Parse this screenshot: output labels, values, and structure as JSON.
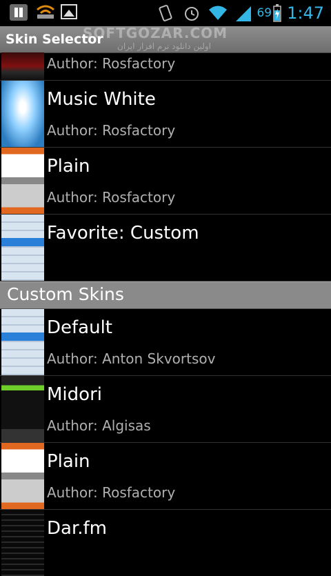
{
  "statusbar": {
    "battery_percent": "69",
    "time": "1:47",
    "accent_color": "#33b5e5",
    "icons": [
      "pause-icon",
      "wifi-signal-icon",
      "image-icon",
      "vibrate-icon",
      "alarm-icon",
      "wifi-icon",
      "cell-signal-icon",
      "battery-charging-icon"
    ]
  },
  "titlebar": {
    "title": "Skin Selector",
    "watermark": "SOFTGOZAR.COM",
    "watermark_sub": "اولین دانلود نرم افزار ایران"
  },
  "skins_top": [
    {
      "name": "",
      "author": "Author: Rosfactory",
      "thumb": "red"
    },
    {
      "name": "Music White",
      "author": "Author: Rosfactory",
      "thumb": "white"
    },
    {
      "name": "Plain",
      "author": "Author: Rosfactory",
      "thumb": "plain"
    },
    {
      "name": "Favorite: Custom",
      "author": "",
      "thumb": "list"
    }
  ],
  "section": {
    "title": "Custom Skins"
  },
  "skins_custom": [
    {
      "name": "Default",
      "author": "Author: Anton Skvortsov",
      "thumb": "list"
    },
    {
      "name": "Midori",
      "author": "Author: Algisas",
      "thumb": "midori"
    },
    {
      "name": "Plain",
      "author": "Author: Rosfactory",
      "thumb": "plain"
    },
    {
      "name": "Dar.fm",
      "author": "",
      "thumb": "dar"
    }
  ]
}
